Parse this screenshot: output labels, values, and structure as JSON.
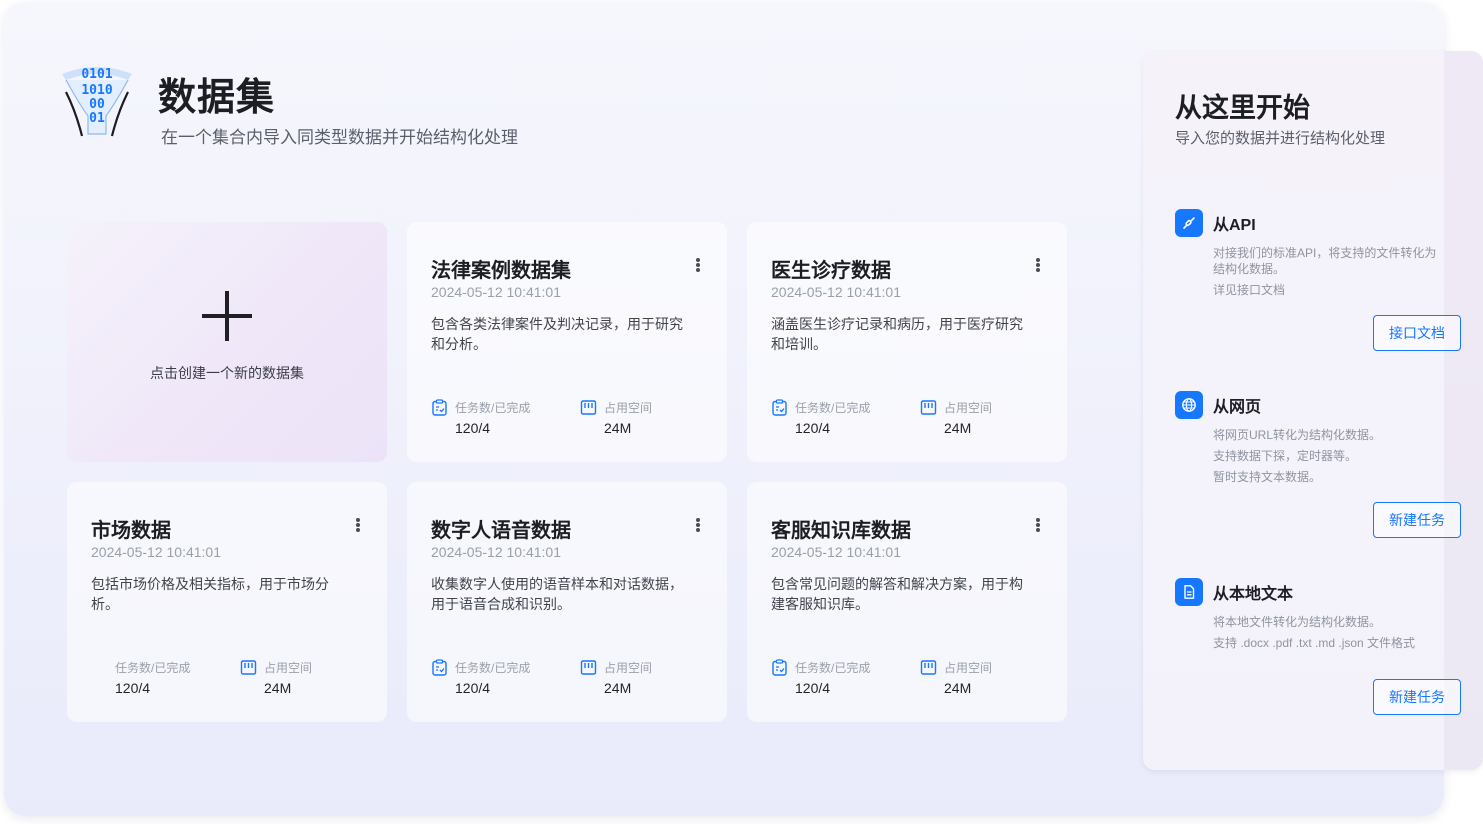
{
  "header": {
    "title": "数据集",
    "subtitle": "在一个集合内导入同类型数据并开始结构化处理",
    "logo_digits": [
      "0101",
      "1010",
      "00",
      "01"
    ]
  },
  "create_card": {
    "label": "点击创建一个新的数据集"
  },
  "stat_labels": {
    "tasks": "任务数/已完成",
    "space": "占用空间"
  },
  "datasets": [
    {
      "title": "法律案例数据集",
      "date": "2024-05-12 10:41:01",
      "desc": "包含各类法律案件及判决记录，用于研究和分析。",
      "tasks": "120/4",
      "space": "24M"
    },
    {
      "title": "医生诊疗数据",
      "date": "2024-05-12 10:41:01",
      "desc": "涵盖医生诊疗记录和病历，用于医疗研究和培训。",
      "tasks": "120/4",
      "space": "24M"
    },
    {
      "title": "市场数据",
      "date": "2024-05-12 10:41:01",
      "desc": "包括市场价格及相关指标，用于市场分析。",
      "tasks": "120/4",
      "space": "24M"
    },
    {
      "title": "数字人语音数据",
      "date": "2024-05-12 10:41:01",
      "desc": "收集数字人使用的语音样本和对话数据，用于语音合成和识别。",
      "tasks": "120/4",
      "space": "24M"
    },
    {
      "title": "客服知识库数据",
      "date": "2024-05-12 10:41:01",
      "desc": "包含常见问题的解答和解决方案，用于构建客服知识库。",
      "tasks": "120/4",
      "space": "24M"
    }
  ],
  "panel": {
    "title": "从这里开始",
    "subtitle": "导入您的数据并进行结构化处理",
    "sources": [
      {
        "icon": "api-link-icon",
        "title": "从API",
        "lines": [
          "对接我们的标准API，将支持的文件转化为结构化数据。",
          "详见接口文档"
        ],
        "button": "接口文档"
      },
      {
        "icon": "globe-icon",
        "title": "从网页",
        "lines": [
          "将网页URL转化为结构化数据。",
          "支持数据下探，定时器等。",
          "暂时支持文本数据。"
        ],
        "button": "新建任务"
      },
      {
        "icon": "document-icon",
        "title": "从本地文本",
        "lines": [
          "将本地文件转化为结构化数据。",
          "支持 .docx .pdf .txt .md .json 文件格式"
        ],
        "button": "新建任务"
      }
    ]
  },
  "colors": {
    "accent": "#1677ff",
    "title": "#1d1d24",
    "muted": "#9aa0aa"
  }
}
